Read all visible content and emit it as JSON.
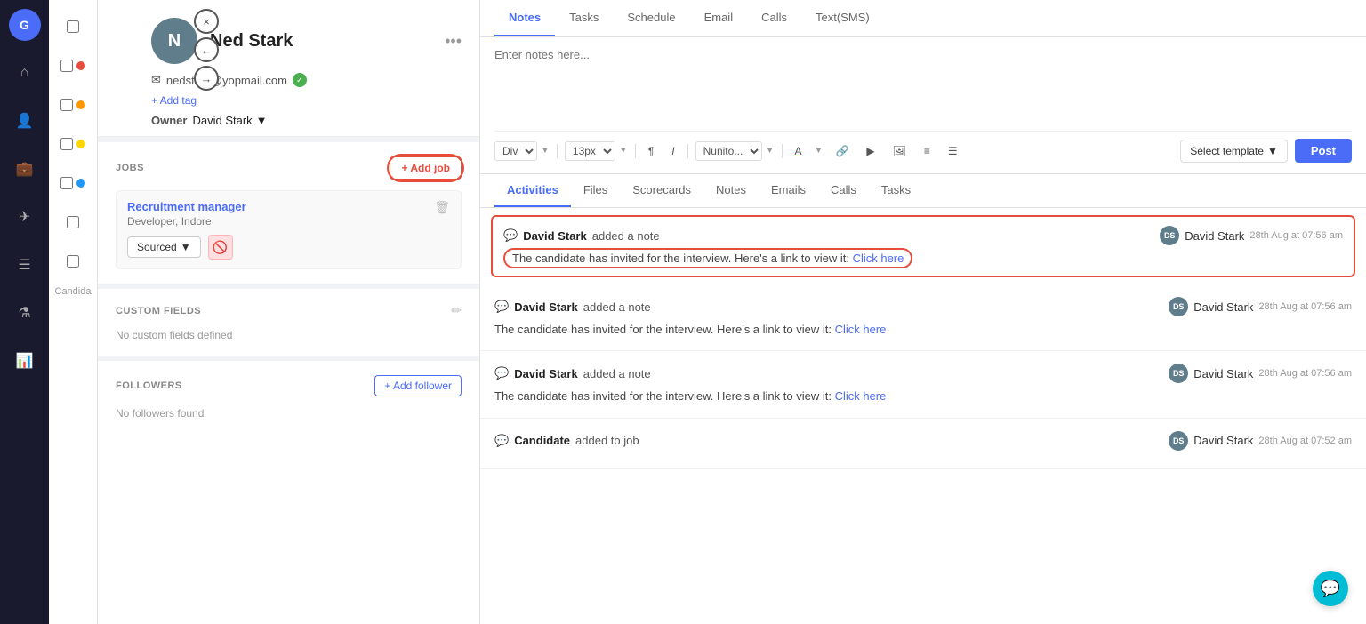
{
  "sidebar": {
    "logo": "G",
    "icons": [
      "home",
      "person",
      "briefcase",
      "send",
      "list",
      "flask",
      "chart"
    ]
  },
  "panelNav": {
    "close": "×",
    "back": "←",
    "forward": "→"
  },
  "profile": {
    "avatar_letter": "N",
    "name": "Ned Stark",
    "email": "nedstark@yopmail.com",
    "email_verified": true,
    "add_tag_label": "+ Add tag",
    "owner_label": "Owner",
    "owner_value": "David Stark"
  },
  "jobs": {
    "section_title": "JOBS",
    "add_job_label": "+ Add job",
    "items": [
      {
        "title": "Recruitment manager",
        "subtitle": "Developer, Indore",
        "status": "Sourced"
      }
    ]
  },
  "custom_fields": {
    "section_title": "CUSTOM FIELDS",
    "no_data": "No custom fields defined"
  },
  "followers": {
    "section_title": "FOLLOWERS",
    "add_follower_label": "+ Add follower",
    "no_data": "No followers found"
  },
  "tabs": {
    "items": [
      "Notes",
      "Tasks",
      "Schedule",
      "Email",
      "Calls",
      "Text(SMS)"
    ],
    "active": "Notes"
  },
  "notes": {
    "placeholder": "Enter notes here...",
    "toolbar": {
      "format": "Div",
      "size": "13px",
      "font": "Nunito...",
      "select_template": "Select template",
      "post_label": "Post"
    }
  },
  "activity_tabs": {
    "items": [
      "Activities",
      "Files",
      "Scorecards",
      "Notes",
      "Emails",
      "Calls",
      "Tasks"
    ],
    "active": "Activities"
  },
  "activities": [
    {
      "id": 1,
      "author": "David Stark",
      "action": "added a note",
      "user": "David Stark",
      "time": "28th Aug at 07:56 am",
      "text": "The candidate has invited for the interview. Here's a link to view it:",
      "link": "Click here",
      "highlighted": true
    },
    {
      "id": 2,
      "author": "David Stark",
      "action": "added a note",
      "user": "David Stark",
      "time": "28th Aug at 07:56 am",
      "text": "The candidate has invited for the interview. Here's a link to view it:",
      "link": "Click here",
      "highlighted": false
    },
    {
      "id": 3,
      "author": "David Stark",
      "action": "added a note",
      "user": "David Stark",
      "time": "28th Aug at 07:56 am",
      "text": "The candidate has invited for the interview. Here's a link to view it:",
      "link": "Click here",
      "highlighted": false
    },
    {
      "id": 4,
      "author": "Candidate",
      "action": "added to job",
      "user": "David Stark",
      "time": "28th Aug at 07:52 am",
      "text": "",
      "link": "",
      "highlighted": false,
      "truncated": true
    }
  ],
  "chat_icon": "💬"
}
